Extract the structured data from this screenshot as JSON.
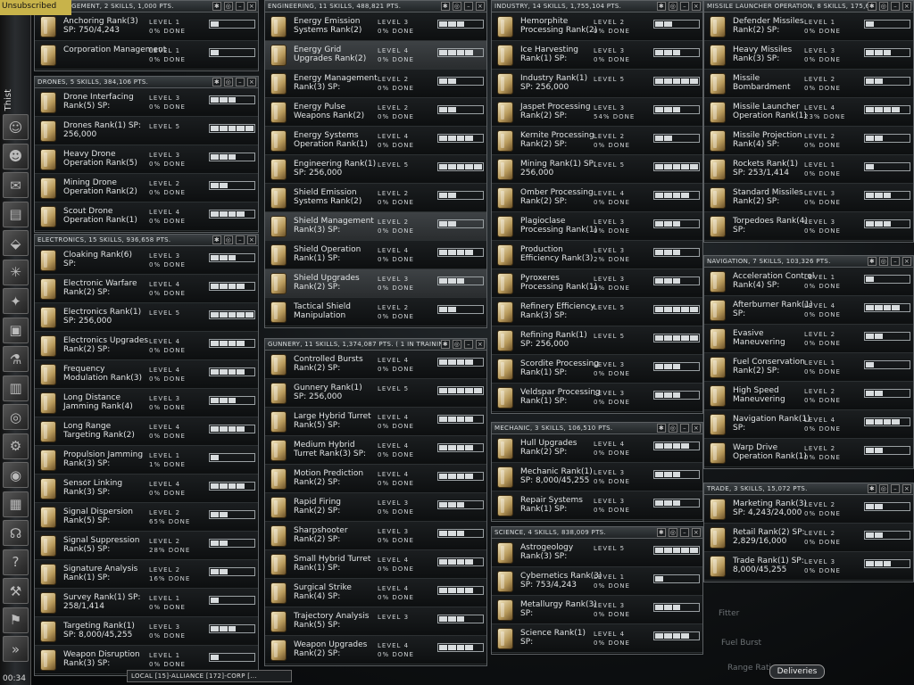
{
  "player": {
    "status": "Unsubscribed",
    "name": "Thist",
    "clock": "00:34"
  },
  "neocom": [
    {
      "name": "character-icon",
      "g": "☺"
    },
    {
      "name": "people-icon",
      "g": "☻"
    },
    {
      "name": "mail-icon",
      "g": "✉"
    },
    {
      "name": "notepad-icon",
      "g": "▤"
    },
    {
      "name": "ship-icon",
      "g": "⬙"
    },
    {
      "name": "map-icon",
      "g": "✳"
    },
    {
      "name": "star-map-icon",
      "g": "✦"
    },
    {
      "name": "cargo-icon",
      "g": "▣"
    },
    {
      "name": "science-icon",
      "g": "⚗"
    },
    {
      "name": "market-icon",
      "g": "▥"
    },
    {
      "name": "help-ring-icon",
      "g": "◎"
    },
    {
      "name": "fitting-icon",
      "g": "⚙"
    },
    {
      "name": "globe-icon",
      "g": "◉"
    },
    {
      "name": "contracts-icon",
      "g": "▦"
    },
    {
      "name": "headset-icon",
      "g": "☊"
    },
    {
      "name": "help-icon",
      "g": "?"
    },
    {
      "name": "settings-icon",
      "g": "⚒"
    },
    {
      "name": "industry-icon",
      "g": "⚑"
    },
    {
      "name": "expand-icon",
      "g": "»"
    }
  ],
  "chat": "LOCAL [15]-ALLIANCE [172]-CORP [...",
  "deliveries": "Deliveries",
  "ghost_text": [
    "Fitter",
    "Fuel Burst",
    "Range Rating"
  ],
  "level_word": "LEVEL",
  "done_word": "DONE",
  "groups": [
    {
      "title": "ION MANAGEMENT, 2 SKILLS, 1,000 PTS.",
      "skills": [
        {
          "name": "Anchoring Rank(3)",
          "sp": "SP: 750/4,243",
          "level": 1,
          "pct": "0%"
        },
        {
          "name": "Corporation Management",
          "sp": "",
          "level": 1,
          "pct": "0%"
        }
      ]
    },
    {
      "title": "DRONES, 5 SKILLS, 384,106 PTS.",
      "skills": [
        {
          "name": "Drone Interfacing",
          "sp": "Rank(5) SP:",
          "level": 3,
          "pct": "0%"
        },
        {
          "name": "Drones Rank(1) SP:",
          "sp": "256,000",
          "level": 5,
          "pct": ""
        },
        {
          "name": "Heavy Drone",
          "sp": "Operation Rank(5)",
          "level": 3,
          "pct": "0%"
        },
        {
          "name": "Mining Drone",
          "sp": "Operation Rank(2)",
          "level": 2,
          "pct": "0%"
        },
        {
          "name": "Scout Drone",
          "sp": "Operation Rank(1)",
          "level": 4,
          "pct": "0%"
        }
      ]
    },
    {
      "title": "ELECTRONICS, 15 SKILLS, 936,658 PTS.",
      "skills": [
        {
          "name": "Cloaking Rank(6)",
          "sp": "SP:",
          "level": 3,
          "pct": "0%"
        },
        {
          "name": "Electronic Warfare",
          "sp": "Rank(2) SP:",
          "level": 4,
          "pct": "0%"
        },
        {
          "name": "Electronics Rank(1)",
          "sp": "SP: 256,000",
          "level": 5,
          "pct": ""
        },
        {
          "name": "Electronics Upgrades",
          "sp": "Rank(2) SP:",
          "level": 4,
          "pct": "0%"
        },
        {
          "name": "Frequency",
          "sp": "Modulation Rank(3)",
          "level": 4,
          "pct": "0%"
        },
        {
          "name": "Long Distance",
          "sp": "Jamming Rank(4)",
          "level": 3,
          "pct": "0%"
        },
        {
          "name": "Long Range",
          "sp": "Targeting Rank(2)",
          "level": 4,
          "pct": "0%"
        },
        {
          "name": "Propulsion Jamming",
          "sp": "Rank(3) SP:",
          "level": 1,
          "pct": "1%"
        },
        {
          "name": "Sensor Linking",
          "sp": "Rank(3) SP:",
          "level": 4,
          "pct": "0%"
        },
        {
          "name": "Signal Dispersion",
          "sp": "Rank(5) SP:",
          "level": 2,
          "pct": "65%"
        },
        {
          "name": "Signal Suppression",
          "sp": "Rank(5) SP:",
          "level": 2,
          "pct": "28%"
        },
        {
          "name": "Signature Analysis",
          "sp": "Rank(1) SP:",
          "level": 2,
          "pct": "16%"
        },
        {
          "name": "Survey Rank(1) SP:",
          "sp": "258/1,414",
          "level": 1,
          "pct": "0%"
        },
        {
          "name": "Targeting Rank(1)",
          "sp": "SP: 8,000/45,255",
          "level": 3,
          "pct": "0%"
        },
        {
          "name": "Weapon Disruption",
          "sp": "Rank(3) SP:",
          "level": 1,
          "pct": "0%"
        }
      ]
    },
    {
      "title": "ENGINEERING, 11 SKILLS, 488,821 PTS.",
      "skills": [
        {
          "name": "Energy Emission",
          "sp": "Systems Rank(2)",
          "level": 3,
          "pct": "0%"
        },
        {
          "name": "Energy Grid",
          "sp": "Upgrades Rank(2)",
          "level": 4,
          "pct": "0%",
          "hi": true
        },
        {
          "name": "Energy Management",
          "sp": "Rank(3) SP:",
          "level": 2,
          "pct": "0%"
        },
        {
          "name": "Energy Pulse",
          "sp": "Weapons Rank(2)",
          "level": 2,
          "pct": "0%"
        },
        {
          "name": "Energy Systems",
          "sp": "Operation Rank(1)",
          "level": 4,
          "pct": "0%"
        },
        {
          "name": "Engineering Rank(1)",
          "sp": "SP: 256,000",
          "level": 5,
          "pct": ""
        },
        {
          "name": "Shield Emission",
          "sp": "Systems Rank(2)",
          "level": 2,
          "pct": "0%"
        },
        {
          "name": "Shield Management",
          "sp": "Rank(3) SP:",
          "level": 2,
          "pct": "0%",
          "hi": true
        },
        {
          "name": "Shield Operation",
          "sp": "Rank(1) SP:",
          "level": 4,
          "pct": "0%"
        },
        {
          "name": "Shield Upgrades",
          "sp": "Rank(2) SP:",
          "level": 3,
          "pct": "0%",
          "hi": true
        },
        {
          "name": "Tactical Shield",
          "sp": "Manipulation",
          "level": 2,
          "pct": "0%"
        }
      ]
    },
    {
      "title": "GUNNERY, 11 SKILLS, 1,374,087 PTS. ( 1 IN TRAINING )",
      "skills": [
        {
          "name": "Controlled Bursts",
          "sp": "Rank(2) SP:",
          "level": 4,
          "pct": "0%"
        },
        {
          "name": "Gunnery Rank(1)",
          "sp": "SP: 256,000",
          "level": 5,
          "pct": ""
        },
        {
          "name": "Large Hybrid Turret",
          "sp": "Rank(5) SP:",
          "level": 4,
          "pct": "0%"
        },
        {
          "name": "Medium Hybrid",
          "sp": "Turret Rank(3) SP:",
          "level": 4,
          "pct": "0%"
        },
        {
          "name": "Motion Prediction",
          "sp": "Rank(2) SP:",
          "level": 4,
          "pct": "0%"
        },
        {
          "name": "Rapid Firing",
          "sp": "Rank(2) SP:",
          "level": 3,
          "pct": "0%"
        },
        {
          "name": "Sharpshooter",
          "sp": "Rank(2) SP:",
          "level": 3,
          "pct": "0%"
        },
        {
          "name": "Small Hybrid Turret",
          "sp": "Rank(1) SP:",
          "level": 4,
          "pct": "0%"
        },
        {
          "name": "Surgical Strike",
          "sp": "Rank(4) SP:",
          "level": 4,
          "pct": "0%"
        },
        {
          "name": "Trajectory Analysis",
          "sp": "Rank(5) SP:",
          "level": 3,
          "pct": ""
        },
        {
          "name": "Weapon Upgrades",
          "sp": "Rank(2) SP:",
          "level": 4,
          "pct": "0%"
        }
      ]
    },
    {
      "title": "INDUSTRY, 14 SKILLS, 1,755,104 PTS.",
      "skills": [
        {
          "name": "Hemorphite",
          "sp": "Processing Rank(2)",
          "level": 2,
          "pct": "0%"
        },
        {
          "name": "Ice Harvesting",
          "sp": "Rank(1) SP:",
          "level": 3,
          "pct": "0%"
        },
        {
          "name": "Industry Rank(1)",
          "sp": "SP: 256,000",
          "level": 5,
          "pct": ""
        },
        {
          "name": "Jaspet Processing",
          "sp": "Rank(2) SP:",
          "level": 3,
          "pct": "54%"
        },
        {
          "name": "Kernite Processing",
          "sp": "Rank(2) SP:",
          "level": 2,
          "pct": "0%"
        },
        {
          "name": "Mining Rank(1) SP:",
          "sp": "256,000",
          "level": 5,
          "pct": ""
        },
        {
          "name": "Omber Processing",
          "sp": "Rank(2) SP:",
          "level": 4,
          "pct": "0%"
        },
        {
          "name": "Plagioclase",
          "sp": "Processing Rank(1)",
          "level": 3,
          "pct": "0%"
        },
        {
          "name": "Production",
          "sp": "Efficiency Rank(3)",
          "level": 3,
          "pct": "2%"
        },
        {
          "name": "Pyroxeres",
          "sp": "Processing Rank(1)",
          "level": 3,
          "pct": "0%"
        },
        {
          "name": "Refinery Efficiency",
          "sp": "Rank(3) SP:",
          "level": 5,
          "pct": ""
        },
        {
          "name": "Refining Rank(1)",
          "sp": "SP: 256,000",
          "level": 5,
          "pct": ""
        },
        {
          "name": "Scordite Processing",
          "sp": "Rank(1) SP:",
          "level": 3,
          "pct": "0%"
        },
        {
          "name": "Veldspar Processing",
          "sp": "Rank(1) SP:",
          "level": 3,
          "pct": "0%"
        }
      ]
    },
    {
      "title": "MECHANIC, 3 SKILLS, 106,510 PTS.",
      "skills": [
        {
          "name": "Hull Upgrades",
          "sp": "Rank(2) SP:",
          "level": 4,
          "pct": "0%"
        },
        {
          "name": "Mechanic Rank(1)",
          "sp": "SP: 8,000/45,255",
          "level": 3,
          "pct": "0%"
        },
        {
          "name": "Repair Systems",
          "sp": "Rank(1) SP:",
          "level": 3,
          "pct": "0%"
        }
      ]
    },
    {
      "title": "SCIENCE, 4 SKILLS, 838,009 PTS.",
      "skills": [
        {
          "name": "Astrogeology",
          "sp": "Rank(3) SP:",
          "level": 5,
          "pct": ""
        },
        {
          "name": "Cybernetics Rank(3)",
          "sp": "SP: 753/4,243",
          "level": 1,
          "pct": "0%"
        },
        {
          "name": "Metallurgy Rank(3)",
          "sp": "SP:",
          "level": 3,
          "pct": "0%"
        },
        {
          "name": "Science Rank(1)",
          "sp": "SP:",
          "level": 4,
          "pct": "0%"
        }
      ]
    },
    {
      "title": "MISSILE LAUNCHER OPERATION, 8 SKILLS, 175,689 PTS.",
      "skills": [
        {
          "name": "Defender Missiles",
          "sp": "Rank(2) SP:",
          "level": 1,
          "pct": "0%"
        },
        {
          "name": "Heavy Missiles",
          "sp": "Rank(3) SP:",
          "level": 3,
          "pct": "0%"
        },
        {
          "name": "Missile",
          "sp": "Bombardment",
          "level": 2,
          "pct": "0%"
        },
        {
          "name": "Missile Launcher",
          "sp": "Operation Rank(1)",
          "level": 4,
          "pct": "23%"
        },
        {
          "name": "Missile Projection",
          "sp": "Rank(4) SP:",
          "level": 2,
          "pct": "0%"
        },
        {
          "name": "Rockets Rank(1)",
          "sp": "SP: 253/1,414",
          "level": 1,
          "pct": "0%"
        },
        {
          "name": "Standard Missiles",
          "sp": "Rank(2) SP:",
          "level": 3,
          "pct": "0%"
        },
        {
          "name": "Torpedoes Rank(4)",
          "sp": "SP:",
          "level": 3,
          "pct": "0%"
        }
      ]
    },
    {
      "title": "NAVIGATION, 7 SKILLS, 103,326 PTS.",
      "skills": [
        {
          "name": "Acceleration Control",
          "sp": "Rank(4) SP:",
          "level": 1,
          "pct": "0%"
        },
        {
          "name": "Afterburner Rank(1)",
          "sp": "SP:",
          "level": 4,
          "pct": "0%"
        },
        {
          "name": "Evasive",
          "sp": "Maneuvering",
          "level": 2,
          "pct": "0%"
        },
        {
          "name": "Fuel Conservation",
          "sp": "Rank(2) SP:",
          "level": 1,
          "pct": "0%"
        },
        {
          "name": "High Speed",
          "sp": "Maneuvering",
          "level": 2,
          "pct": "0%"
        },
        {
          "name": "Navigation Rank(1)",
          "sp": "SP:",
          "level": 4,
          "pct": "0%"
        },
        {
          "name": "Warp Drive",
          "sp": "Operation Rank(1)",
          "level": 2,
          "pct": "0%"
        }
      ]
    },
    {
      "title": "TRADE, 3 SKILLS, 15,072 PTS.",
      "skills": [
        {
          "name": "Marketing Rank(3)",
          "sp": "SP: 4,243/24,000",
          "level": 2,
          "pct": "0%"
        },
        {
          "name": "Retail Rank(2) SP:",
          "sp": "2,829/16,000",
          "level": 2,
          "pct": "0%"
        },
        {
          "name": "Trade Rank(1) SP:",
          "sp": "8,000/45,255",
          "level": 3,
          "pct": "0%"
        }
      ]
    }
  ]
}
